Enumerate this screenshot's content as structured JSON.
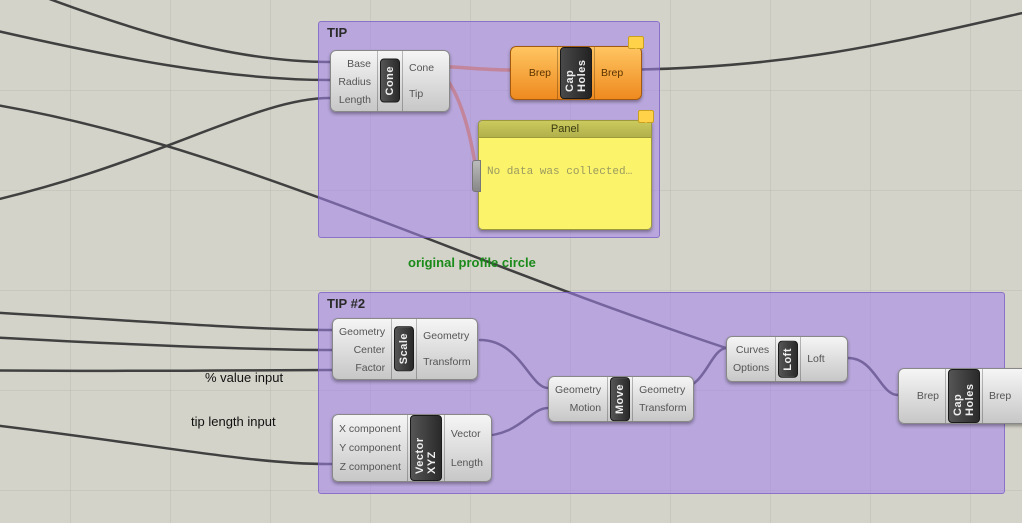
{
  "groups": {
    "tip": {
      "label": "TIP"
    },
    "tip2": {
      "label": "TIP #2"
    }
  },
  "annotations": {
    "profile": "original profile circle",
    "pct": "% value input",
    "len": "tip length input"
  },
  "nodes": {
    "cone": {
      "name": "Cone",
      "in": [
        "Base",
        "Radius",
        "Length"
      ],
      "out": [
        "Cone",
        "Tip"
      ]
    },
    "cap1": {
      "name": "Cap Holes",
      "in": [
        "Brep"
      ],
      "out": [
        "Brep"
      ]
    },
    "panel": {
      "title": "Panel",
      "body": "No data was collected…"
    },
    "scale": {
      "name": "Scale",
      "in": [
        "Geometry",
        "Center",
        "Factor"
      ],
      "out": [
        "Geometry",
        "Transform"
      ]
    },
    "xyz": {
      "name": "Vector XYZ",
      "in": [
        "X component",
        "Y component",
        "Z component"
      ],
      "out": [
        "Vector",
        "Length"
      ]
    },
    "move": {
      "name": "Move",
      "in": [
        "Geometry",
        "Motion"
      ],
      "out": [
        "Geometry",
        "Transform"
      ]
    },
    "loft": {
      "name": "Loft",
      "in": [
        "Curves",
        "Options"
      ],
      "out": [
        "Loft"
      ]
    },
    "cap2": {
      "name": "Cap Holes",
      "in": [
        "Brep"
      ],
      "out": [
        "Brep"
      ]
    }
  }
}
